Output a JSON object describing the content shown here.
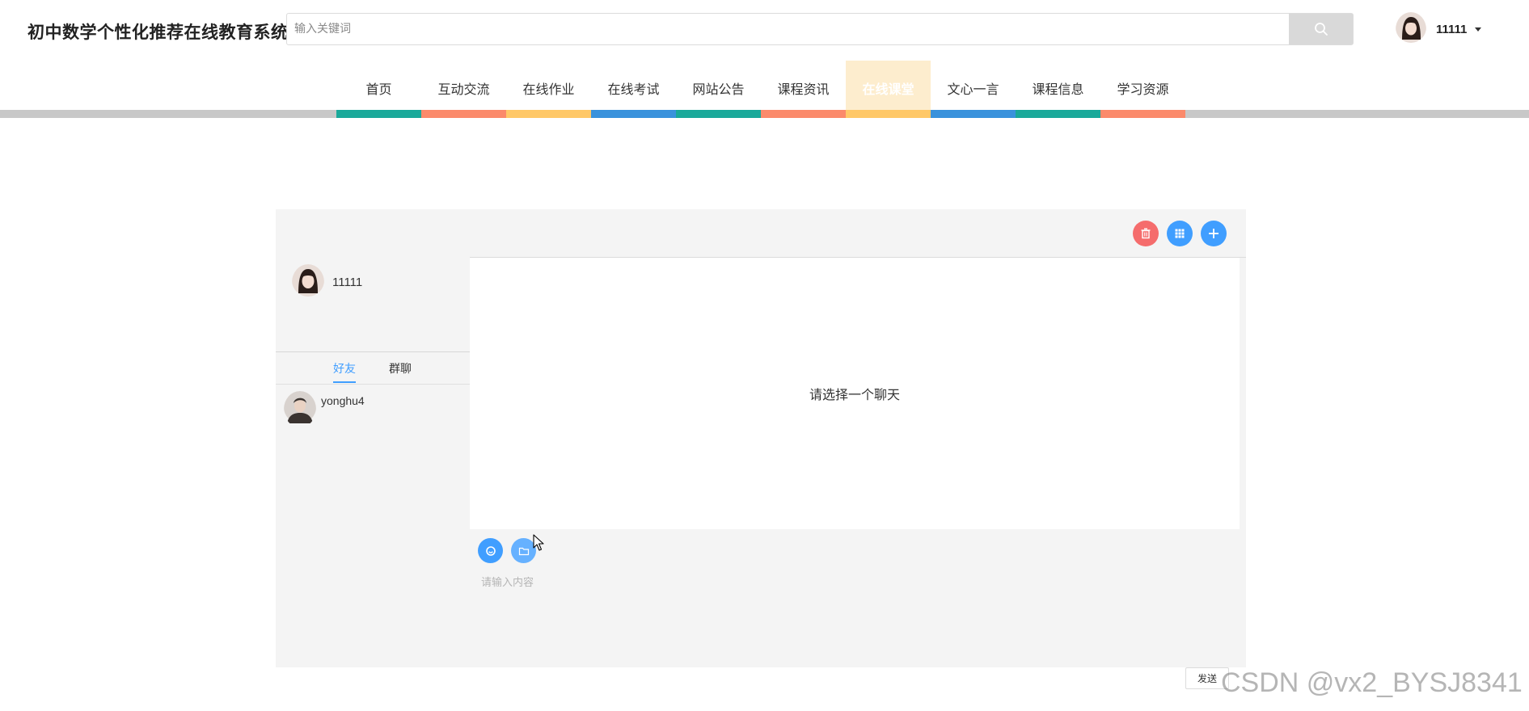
{
  "header": {
    "site_title": "初中数学个性化推荐在线教育系统",
    "search_placeholder": "输入关键词",
    "search_icon": "search-icon",
    "user_name": "11111"
  },
  "nav": {
    "items": [
      {
        "label": "首页",
        "color": "#1aa99a"
      },
      {
        "label": "互动交流",
        "color": "#fb8a6b"
      },
      {
        "label": "在线作业",
        "color": "#ffc868"
      },
      {
        "label": "在线考试",
        "color": "#3a92dc"
      },
      {
        "label": "网站公告",
        "color": "#1aa99a"
      },
      {
        "label": "课程资讯",
        "color": "#fb8a6b"
      },
      {
        "label": "在线课堂",
        "color": "#ffc868",
        "active": true
      },
      {
        "label": "文心一言",
        "color": "#3a92dc"
      },
      {
        "label": "课程信息",
        "color": "#1aa99a"
      },
      {
        "label": "学习资源",
        "color": "#fb8a6b"
      }
    ],
    "bar_color": "#c8c8c8"
  },
  "chat": {
    "actions": [
      {
        "icon": "trash-icon",
        "color": "#f56c6c"
      },
      {
        "icon": "grid-icon",
        "color": "#409eff"
      },
      {
        "icon": "plus-icon",
        "color": "#409eff"
      }
    ],
    "me_name": "11111",
    "tabs": {
      "friends": "好友",
      "groups": "群聊"
    },
    "friends": [
      {
        "name": "yonghu4"
      }
    ],
    "empty_text": "请选择一个聊天",
    "tools": [
      {
        "icon": "emoji-icon",
        "color": "#409eff"
      },
      {
        "icon": "folder-icon",
        "color": "#66b1ff"
      }
    ],
    "input_placeholder": "请输入内容",
    "send_label": "发送"
  },
  "watermark": "CSDN @vx2_BYSJ8341"
}
